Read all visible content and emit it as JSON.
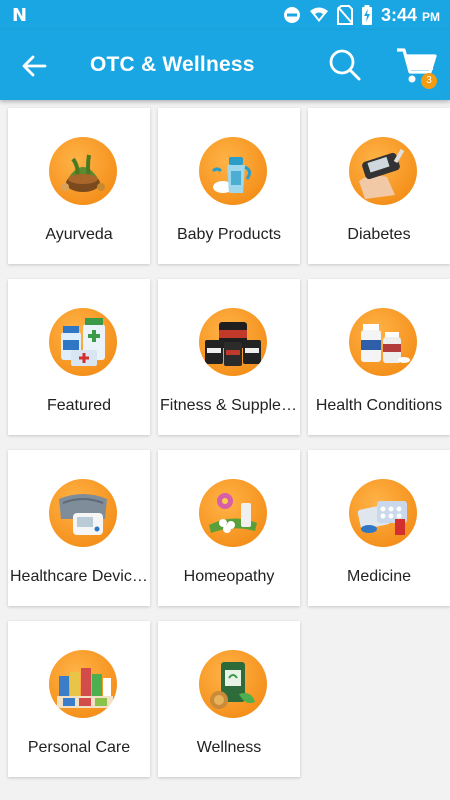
{
  "status_bar": {
    "time": "3:44",
    "ampm": "PM",
    "notification_icon": "n-icon",
    "icons": [
      "dnd-icon",
      "wifi-icon",
      "no-sim-icon",
      "battery-charging-icon"
    ]
  },
  "app_bar": {
    "title": "OTC & Wellness",
    "cart_count": "3",
    "colors": {
      "primary": "#1aa6e2",
      "badge": "#f39c12",
      "icon_bg": "#f5921e"
    }
  },
  "categories": [
    {
      "label": "Ayurveda",
      "icon": "ayurveda-icon"
    },
    {
      "label": "Baby Products",
      "icon": "baby-bottle-icon"
    },
    {
      "label": "Diabetes",
      "icon": "glucometer-icon"
    },
    {
      "label": "Featured",
      "icon": "medicine-bottles-icon"
    },
    {
      "label": "Fitness & Supplements",
      "icon": "supplement-tubs-icon"
    },
    {
      "label": "Health Conditions",
      "icon": "pill-bottles-icon"
    },
    {
      "label": "Healthcare Devices",
      "icon": "bp-monitor-icon"
    },
    {
      "label": "Homeopathy",
      "icon": "homeopathy-flower-icon"
    },
    {
      "label": "Medicine",
      "icon": "medicine-strips-icon"
    },
    {
      "label": "Personal Care",
      "icon": "personal-care-products-icon"
    },
    {
      "label": "Wellness",
      "icon": "wellness-tube-icon"
    }
  ]
}
